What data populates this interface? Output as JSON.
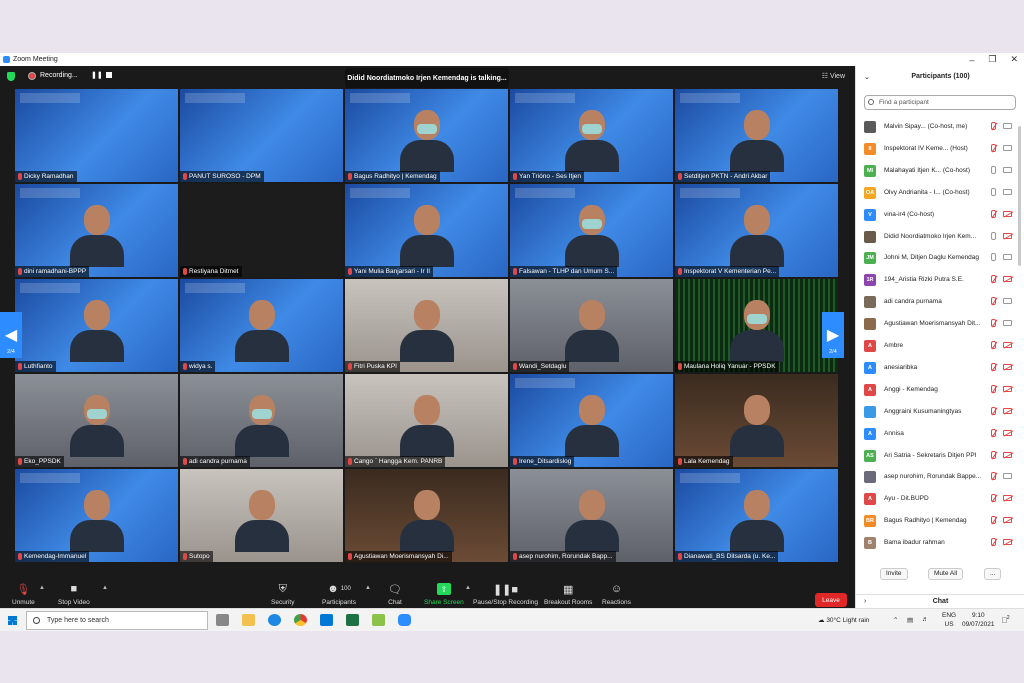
{
  "window": {
    "title": "Zoom Meeting"
  },
  "topbar": {
    "recording_label": "Recording...",
    "talking": "Didid Noordiatmoko Irjen Kemendag is talking...",
    "view_label": "View"
  },
  "pager": {
    "left": "2/4",
    "right": "2/4"
  },
  "tiles": [
    {
      "name": "Dicky Ramadhan",
      "bg": "A"
    },
    {
      "name": "PANUT SUROSO - DPM",
      "bg": "A"
    },
    {
      "name": "Bagus Radhityo | Kemendag",
      "bg": "A",
      "person": true,
      "mask": true
    },
    {
      "name": "Yan Trióno - Ses Itjen",
      "bg": "A",
      "person": true,
      "mask": true
    },
    {
      "name": "Setditjen PKTN - Andri Akbar",
      "bg": "A",
      "person": true
    },
    {
      "name": "dini ramadhani-BPPP",
      "bg": "A",
      "person": true
    },
    {
      "name": "Restiyana Ditmet",
      "bg": "F"
    },
    {
      "name": "Yani Mulia Banjarsari - Ir II",
      "bg": "A",
      "person": true
    },
    {
      "name": "Falsawan - TLHP dan Umum S...",
      "bg": "A",
      "person": true,
      "mask": true
    },
    {
      "name": "Inspektorat V Kementerian Pe...",
      "bg": "A",
      "person": true
    },
    {
      "name": "Luthfianto",
      "bg": "A",
      "person": true
    },
    {
      "name": "widya s.",
      "bg": "A",
      "person": true
    },
    {
      "name": "Fitri Puska KPI",
      "bg": "C",
      "person": true
    },
    {
      "name": "Wandi_Setdaglu",
      "bg": "B",
      "person": true
    },
    {
      "name": "Maulana Holiq Yanuar - PPSDK",
      "bg": "D",
      "person": true,
      "mask": true
    },
    {
      "name": "Eko_PPSDK",
      "bg": "B",
      "person": true,
      "mask": true
    },
    {
      "name": "adi candra purnama",
      "bg": "B",
      "person": true,
      "mask": true
    },
    {
      "name": "Cango ` Hangga Kem. PANRB",
      "bg": "C",
      "person": true
    },
    {
      "name": "Irene_Ditsardislog",
      "bg": "A",
      "person": true
    },
    {
      "name": "Lala Kemendag",
      "bg": "E",
      "person": true
    },
    {
      "name": "Kemendag-Immanuel",
      "bg": "A",
      "person": true
    },
    {
      "name": "Sutopo",
      "bg": "C",
      "person": true
    },
    {
      "name": "Agustiawan Moerismansyah Di...",
      "bg": "E",
      "person": true
    },
    {
      "name": "asep nurohim, Rorundak Bapp...",
      "bg": "B",
      "person": true
    },
    {
      "name": "Dianawati_BS Ditsarda (u. Ke...",
      "bg": "A",
      "person": true
    }
  ],
  "toolbar": {
    "unmute": "Unmute",
    "stop_video": "Stop Video",
    "security": "Security",
    "participants": "Participants",
    "participants_count": "100",
    "chat": "Chat",
    "share_screen": "Share Screen",
    "record": "Pause/Stop Recording",
    "breakout": "Breakout Rooms",
    "reactions": "Reactions",
    "leave": "Leave"
  },
  "panel": {
    "title": "Participants (100)",
    "search_placeholder": "Find a participant",
    "invite": "Invite",
    "mute_all": "Mute All",
    "more": "...",
    "chat_title": "Chat"
  },
  "participants": [
    {
      "name": "Malvin Sipay... (Co-host, me)",
      "initials": "",
      "color": "#5a5a5a",
      "mic": "off",
      "cam": "on"
    },
    {
      "name": "Inspektorat IV Keme... (Host)",
      "initials": "II",
      "color": "#f28c28",
      "mic": "off",
      "cam": "on"
    },
    {
      "name": "Malahayati Itjen K... (Co-host)",
      "initials": "MI",
      "color": "#4caf50",
      "mic": "on",
      "cam": "on"
    },
    {
      "name": "Olvy Andrianita - I... (Co-host)",
      "initials": "OA",
      "color": "#f5a623",
      "mic": "on",
      "cam": "on"
    },
    {
      "name": "vina-ir4 (Co-host)",
      "initials": "V",
      "color": "#2d8cff",
      "mic": "off",
      "cam": "off"
    },
    {
      "name": "Didid Noordiatmoko Irjen Kem...",
      "initials": "",
      "color": "#6a5a4a",
      "mic": "on",
      "cam": "off"
    },
    {
      "name": "Johni M, Ditjen Daglu Kemendag",
      "initials": "JM",
      "color": "#4caf50",
      "mic": "on",
      "cam": "on"
    },
    {
      "name": "194_Aristia Rizki Putra S.E.",
      "initials": "1R",
      "color": "#8e44ad",
      "mic": "off",
      "cam": "off"
    },
    {
      "name": "adi candra purnama",
      "initials": "",
      "color": "#7a6a5a",
      "mic": "off",
      "cam": "on"
    },
    {
      "name": "Agustiawan Moerismansyah Dit...",
      "initials": "",
      "color": "#8a6a4a",
      "mic": "off",
      "cam": "on"
    },
    {
      "name": "Ambre",
      "initials": "A",
      "color": "#e04848",
      "mic": "off",
      "cam": "off"
    },
    {
      "name": "anesiaribka",
      "initials": "A",
      "color": "#2d8cff",
      "mic": "off",
      "cam": "off"
    },
    {
      "name": "Anggi - Kemendag",
      "initials": "A",
      "color": "#e04848",
      "mic": "off",
      "cam": "off"
    },
    {
      "name": "Anggraini Kusumaningtyas",
      "initials": "",
      "color": "#3a9ae6",
      "mic": "off",
      "cam": "off"
    },
    {
      "name": "Annisa",
      "initials": "A",
      "color": "#2d8cff",
      "mic": "off",
      "cam": "off"
    },
    {
      "name": "Ari Satria - Sekretaris Ditjen PPI",
      "initials": "AS",
      "color": "#4caf50",
      "mic": "off",
      "cam": "off"
    },
    {
      "name": "asep nurohim, Rorundak Bappe...",
      "initials": "",
      "color": "#6a6a7a",
      "mic": "off",
      "cam": "on"
    },
    {
      "name": "Ayu - Dit.BUPD",
      "initials": "A",
      "color": "#e04848",
      "mic": "off",
      "cam": "off"
    },
    {
      "name": "Bagus Radhityo | Kemendag",
      "initials": "BR",
      "color": "#f28c28",
      "mic": "off",
      "cam": "off"
    },
    {
      "name": "Bama ibadur rahman",
      "initials": "B",
      "color": "#a0826d",
      "mic": "off",
      "cam": "off"
    }
  ],
  "taskbar": {
    "search_placeholder": "Type here to search",
    "weather": "30°C  Light rain",
    "lang": "ENG",
    "region": "US",
    "time": "9:10",
    "date": "09/07/2021",
    "notif_count": "2"
  }
}
